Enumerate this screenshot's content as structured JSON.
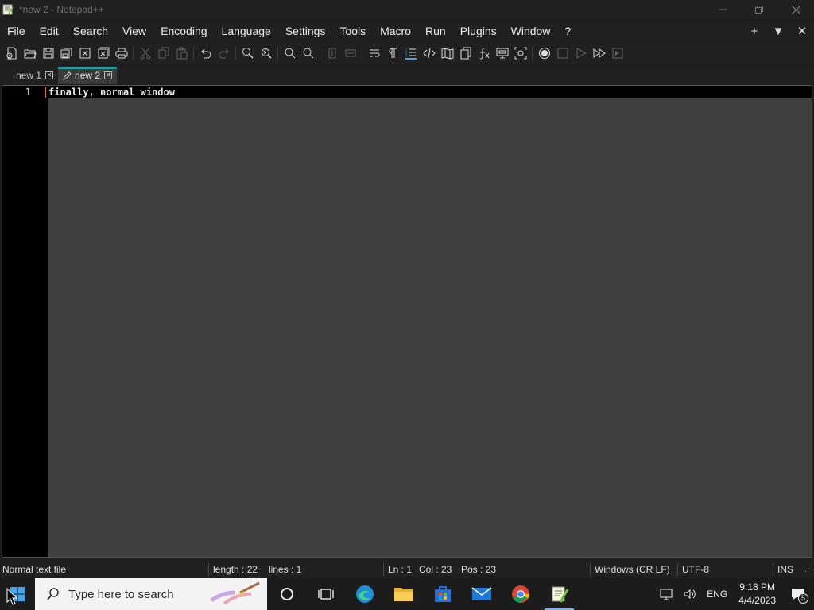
{
  "window": {
    "title": "*new 2 - Notepad++"
  },
  "menu": {
    "items": [
      "File",
      "Edit",
      "Search",
      "View",
      "Encoding",
      "Language",
      "Settings",
      "Tools",
      "Macro",
      "Run",
      "Plugins",
      "Window",
      "?"
    ]
  },
  "tabs": [
    {
      "label": "new 1",
      "active": false
    },
    {
      "label": "new 2",
      "active": true,
      "modified": true
    }
  ],
  "editor": {
    "line_number": "1",
    "line_text": "finally, normal window"
  },
  "status": {
    "file_type": "Normal text file",
    "length": "length : 22",
    "lines": "lines : 1",
    "ln": "Ln : 1",
    "col": "Col : 23",
    "pos": "Pos : 23",
    "eol": "Windows (CR LF)",
    "encoding": "UTF-8",
    "mode": "INS"
  },
  "taskbar": {
    "search_placeholder": "Type here to search",
    "language": "ENG",
    "time": "9:18 PM",
    "date": "4/4/2023",
    "notifications": "5"
  },
  "colors": {
    "accent_tab": "#2b9e9e",
    "caret": "#e07a2c",
    "editor_bg": "#3f3f3f"
  }
}
